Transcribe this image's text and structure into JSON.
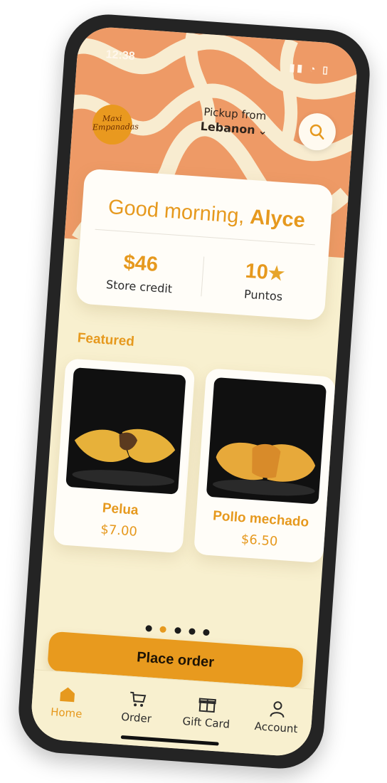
{
  "status": {
    "time": "12:38",
    "icons": "▮▮ ◔ ▯"
  },
  "brand": {
    "logo_text": "Maxi Empanadas"
  },
  "header": {
    "pickup_label": "Pickup from",
    "location": "Lebanon",
    "chevron": "⌄"
  },
  "account": {
    "greeting": "Good morning, ",
    "name": "Alyce",
    "store_credit_value": "$46",
    "store_credit_label": "Store credit",
    "points_value": "10",
    "points_label": "Puntos",
    "points_star": "★"
  },
  "featured": {
    "heading": "Featured",
    "items": [
      {
        "name": "Pelua",
        "price": "$7.00"
      },
      {
        "name": "Pollo mechado",
        "price": "$6.50"
      }
    ]
  },
  "carousel": {
    "total": 5,
    "active": 2
  },
  "actions": {
    "place_order": "Place order"
  },
  "tabs": [
    {
      "label": "Home",
      "icon": "house-icon"
    },
    {
      "label": "Order",
      "icon": "cart-icon"
    },
    {
      "label": "Gift Card",
      "icon": "gift-icon"
    },
    {
      "label": "Account",
      "icon": "user-icon"
    }
  ],
  "colors": {
    "accent": "#e6991e",
    "hero": "#ee9a66",
    "background": "#f8f0cf"
  }
}
